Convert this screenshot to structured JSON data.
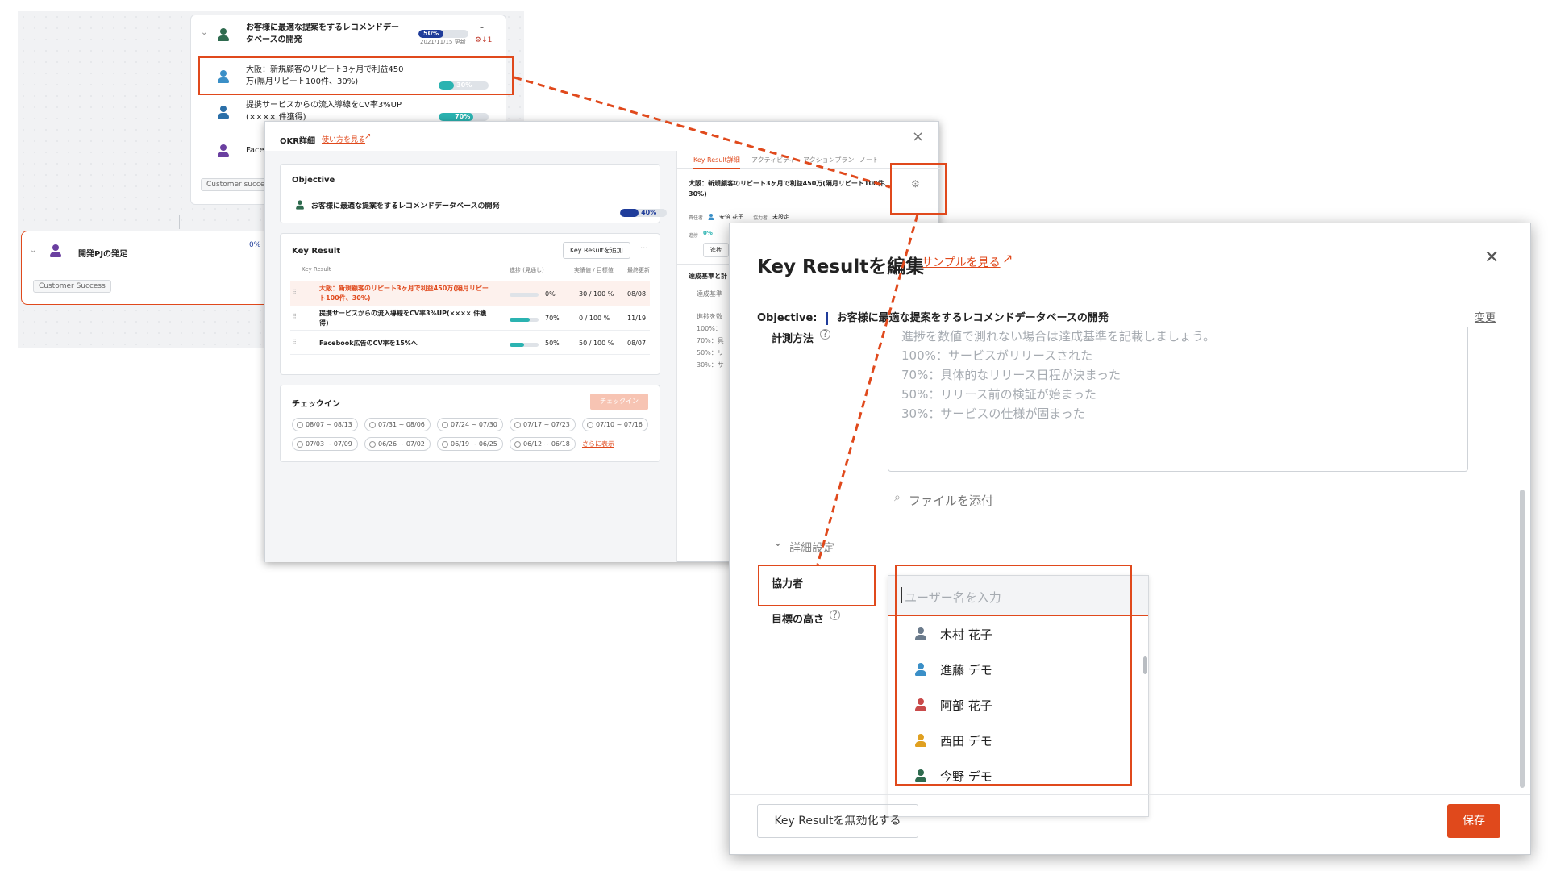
{
  "tree": {
    "objective_card": {
      "title_line1": "お客様に最適な提案をするレコメンドデー",
      "title_line2": "タベースの開発",
      "progress": "50%",
      "progress_value": 0.5,
      "date": "2021/11/15 更新",
      "dash": "–",
      "alert": "⚙↓1"
    },
    "kr_items": [
      {
        "line1": "大阪：新規顧客のリピート3ヶ月で利益450",
        "line2": "万(隔月リピート100件、30%)",
        "progress": "30%",
        "value": 0.3
      },
      {
        "line1": "提携サービスからの流入導線をCV率3%UP",
        "line2": "(×××× 件獲得)",
        "progress": "70%",
        "value": 0.7
      },
      {
        "line1": "Face",
        "line2": "",
        "progress": "",
        "value": 0
      }
    ],
    "customer_tag": "Customer success",
    "dev_card": {
      "title": "開発PJの発足",
      "progress": "0%",
      "value": 0,
      "tag": "Customer Success"
    }
  },
  "okr_modal": {
    "title": "OKR詳細",
    "howto": "使い方を見る",
    "close": "×",
    "objective_label": "Objective",
    "objective_title": "お客様に最適な提案をするレコメンドデータベースの開発",
    "objective_progress": "40%",
    "objective_value": 0.4,
    "kr_section_title": "Key Result",
    "add_kr": "Key Resultを追加",
    "more": "···",
    "columns": [
      "Key Result",
      "進捗 (見通し)",
      "実績値 / 目標値",
      "最終更新"
    ],
    "rows": [
      {
        "name1": "大阪：新規顧客のリピート3ヶ月で利益450万(隔月リピー",
        "name2": "ト100件、30%)",
        "progress": "0%",
        "value": 0,
        "actual": "30 / 100 %",
        "date": "08/08"
      },
      {
        "name1": "提携サービスからの流入導線をCV率3%UP(×××× 件獲",
        "name2": "得)",
        "progress": "70%",
        "value": 0.7,
        "actual": "0 / 100 %",
        "date": "11/19"
      },
      {
        "name1": "Facebook広告のCV率を15%へ",
        "name2": "",
        "progress": "50%",
        "value": 0.5,
        "actual": "50 / 100 %",
        "date": "08/07"
      }
    ],
    "checkin_title": "チェックイン",
    "checkin_button": "チェックイン",
    "weeks": [
      "08/07 ~ 08/13",
      "07/31 ~ 08/06",
      "07/24 ~ 07/30",
      "07/17 ~ 07/23",
      "07/10 ~ 07/16",
      "07/03 ~ 07/09",
      "06/26 ~ 07/02",
      "06/19 ~ 06/25",
      "06/12 ~ 06/18"
    ],
    "show_more": "さらに表示",
    "tabs": [
      "Key Result詳細",
      "アクティビティ",
      "アクションプラン",
      "ノート"
    ],
    "right_title1": "大阪：新規顧客のリピート3ヶ月で利益450万(隔月リピート100件、",
    "right_title2": "30%)",
    "owner_label": "責任者",
    "owner_name": "安倍 花子",
    "collab_label": "協力者",
    "collab_value": "未設定",
    "progress_label": "進捗",
    "progress_value": "0%",
    "checkin_short": "進捗",
    "criteria_title": "達成基準と計",
    "criteria_sub": "達成基準",
    "criteria_lines": [
      "進捗を数",
      "100%：",
      "70%：具",
      "50%：リ",
      "30%：サ"
    ]
  },
  "kr_modal": {
    "title": "Key Resultを編集",
    "sample_link": "サンプルを見る",
    "close": "✕",
    "objective_label": "Objective:",
    "objective_text": "お客様に最適な提案をするレコメンドデータベースの開発",
    "change": "変更",
    "measure_label": "計測方法",
    "measure_lines": [
      "進捗を数値で測れない場合は達成基準を記載しましょう。",
      "100%：サービスがリリースされた",
      "70%：具体的なリリース日程が決まった",
      "50%：リリース前の検証が始まった",
      "30%：サービスの仕様が固まった"
    ],
    "attach": "ファイルを添付",
    "details": "詳細設定",
    "collab_label": "協力者",
    "goal_label": "目標の高さ",
    "user_placeholder": "ユーザー名を入力",
    "users": [
      {
        "name": "木村 花子",
        "color": "#6b7b8c"
      },
      {
        "name": "進藤 デモ",
        "color": "#3a8fc7"
      },
      {
        "name": "阿部 花子",
        "color": "#c94a4a"
      },
      {
        "name": "西田 デモ",
        "color": "#e0a020"
      },
      {
        "name": "今野 デモ",
        "color": "#2f6b4f"
      }
    ],
    "deactivate": "Key Resultを無効化する",
    "save": "保存"
  },
  "colors": {
    "accent": "#e0491c",
    "teal": "#2bb3b1",
    "navy": "#1f3c9a"
  }
}
